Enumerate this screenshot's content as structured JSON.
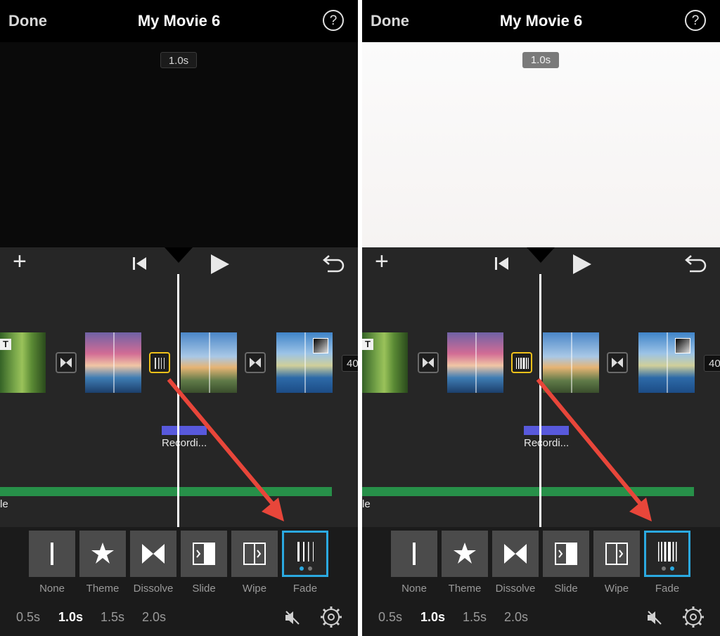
{
  "panels": [
    {
      "nav": {
        "done": "Done",
        "title": "My Movie 6",
        "help": "?"
      },
      "preview_duration": "1.0s",
      "partial_duration": "40",
      "audio_clip_label": "Recordi...",
      "music_clip_label": "le",
      "transitions": [
        {
          "label": "None",
          "icon": "none-icon"
        },
        {
          "label": "Theme",
          "icon": "star-icon"
        },
        {
          "label": "Dissolve",
          "icon": "dissolve-icon"
        },
        {
          "label": "Slide",
          "icon": "slide-icon"
        },
        {
          "label": "Wipe",
          "icon": "wipe-icon"
        },
        {
          "label": "Fade",
          "icon": "fade-icon",
          "selected": true,
          "style_index": 0
        }
      ],
      "durations": [
        {
          "label": "0.5s"
        },
        {
          "label": "1.0s",
          "active": true
        },
        {
          "label": "1.5s"
        },
        {
          "label": "2.0s"
        }
      ]
    },
    {
      "nav": {
        "done": "Done",
        "title": "My Movie 6",
        "help": "?"
      },
      "preview_duration": "1.0s",
      "partial_duration": "40",
      "audio_clip_label": "Recordi...",
      "music_clip_label": "le",
      "transitions": [
        {
          "label": "None",
          "icon": "none-icon"
        },
        {
          "label": "Theme",
          "icon": "star-icon"
        },
        {
          "label": "Dissolve",
          "icon": "dissolve-icon"
        },
        {
          "label": "Slide",
          "icon": "slide-icon"
        },
        {
          "label": "Wipe",
          "icon": "wipe-icon"
        },
        {
          "label": "Fade",
          "icon": "fade-icon",
          "selected": true,
          "style_index": 1
        }
      ],
      "durations": [
        {
          "label": "0.5s"
        },
        {
          "label": "1.0s",
          "active": true
        },
        {
          "label": "1.5s"
        },
        {
          "label": "2.0s"
        }
      ]
    }
  ],
  "colors": {
    "selection_blue": "#2ba9e0",
    "selected_transition_yellow": "#f0c11a",
    "arrow_red": "#e8463a",
    "audio_purple": "#5859dc",
    "music_green": "#279049"
  },
  "preview_backgrounds": [
    "black",
    "white"
  ]
}
